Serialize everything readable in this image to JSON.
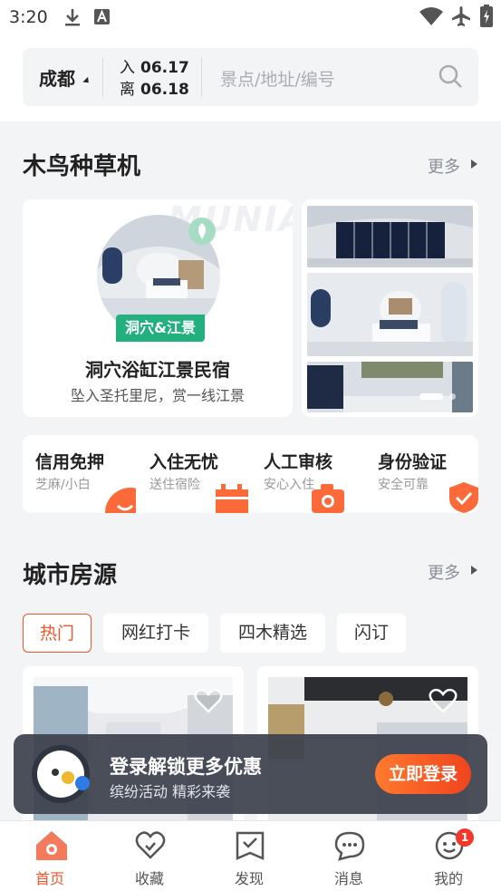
{
  "status": {
    "time": "3:20"
  },
  "search": {
    "city": "成都",
    "checkin_label": "入",
    "checkin_date": "06.17",
    "checkout_label": "离",
    "checkout_date": "06.18",
    "placeholder": "景点/地址/编号"
  },
  "section1": {
    "title": "木鸟种草机",
    "more": "更多",
    "feature": {
      "watermark": "MUNIAO",
      "tag": "洞穴&江景",
      "title": "洞穴浴缸江景民宿",
      "subtitle": "坠入圣托里尼，赏一线江景"
    }
  },
  "benefits": [
    {
      "title": "信用免押",
      "subtitle": "芝麻/小白",
      "icon": "smile-icon"
    },
    {
      "title": "入住无忧",
      "subtitle": "送住宿险",
      "icon": "calendar-icon"
    },
    {
      "title": "人工审核",
      "subtitle": "安心入住",
      "icon": "camera-icon"
    },
    {
      "title": "身份验证",
      "subtitle": "安全可靠",
      "icon": "shield-check-icon"
    }
  ],
  "section2": {
    "title": "城市房源",
    "more": "更多",
    "tabs": [
      {
        "label": "热门",
        "active": true
      },
      {
        "label": "网红打卡",
        "active": false
      },
      {
        "label": "四木精选",
        "active": false
      },
      {
        "label": "闪订",
        "active": false
      }
    ]
  },
  "login_banner": {
    "title": "登录解锁更多优惠",
    "subtitle": "缤纷活动 精彩来袭",
    "button": "立即登录"
  },
  "tabbar": {
    "items": [
      {
        "label": "首页",
        "icon": "home-icon",
        "active": true
      },
      {
        "label": "收藏",
        "icon": "heart-icon",
        "active": false
      },
      {
        "label": "发现",
        "icon": "discover-icon",
        "active": false
      },
      {
        "label": "消息",
        "icon": "message-icon",
        "active": false
      },
      {
        "label": "我的",
        "icon": "profile-icon",
        "active": false
      }
    ],
    "profile_badge": "1"
  },
  "colors": {
    "accent": "#f2542d",
    "green_tag": "#22b07f"
  }
}
